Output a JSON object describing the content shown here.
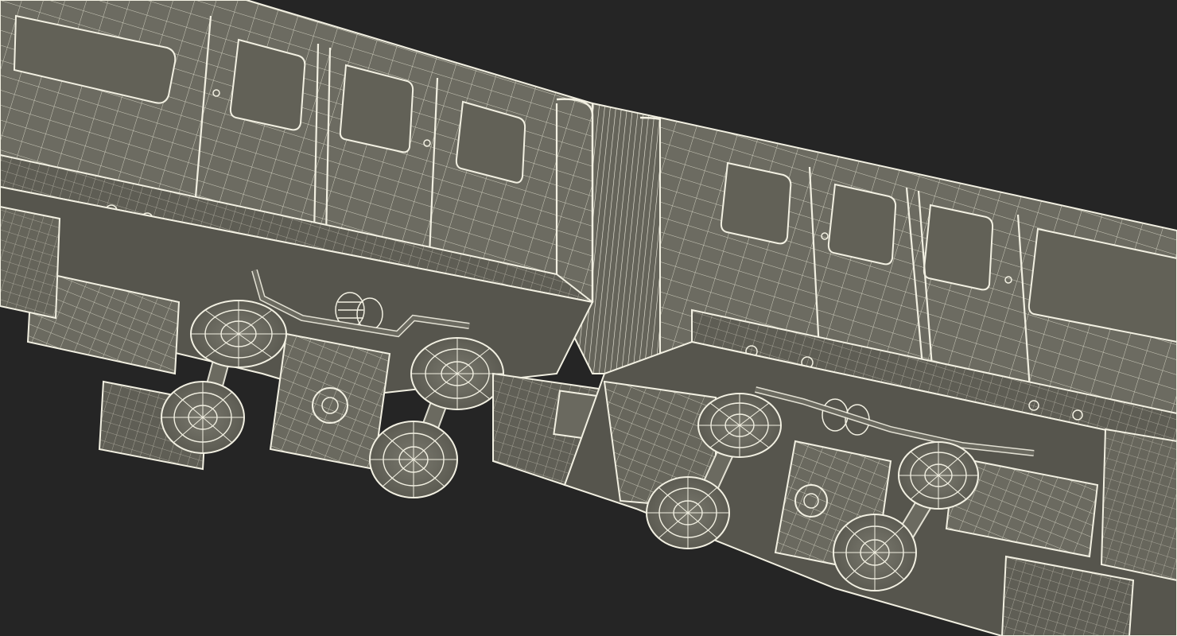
{
  "scene": {
    "subject": "wireframe-train-cars-underside",
    "background_color": "#252525",
    "mesh_face_color": "#6b6a60",
    "mesh_face_dark": "#57564e",
    "mesh_line_color": "#f2f0e2",
    "mesh_line_dim": "#c9c7b8"
  }
}
